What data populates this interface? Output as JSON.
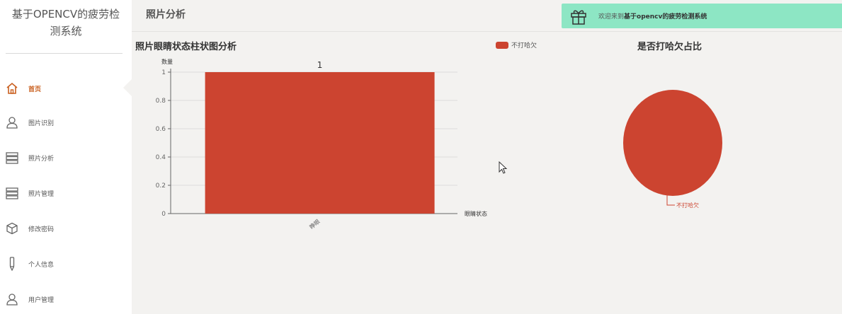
{
  "sidebar": {
    "app_title": "基于OPENCV的疲劳检测系统",
    "items": [
      {
        "label": "首页",
        "icon": "home-icon",
        "active": true
      },
      {
        "label": "图片识别",
        "icon": "user-icon"
      },
      {
        "label": "照片分析",
        "icon": "list-icon"
      },
      {
        "label": "照片管理",
        "icon": "list-icon"
      },
      {
        "label": "修改密码",
        "icon": "cube-icon"
      },
      {
        "label": "个人信息",
        "icon": "pen-icon"
      },
      {
        "label": "用户管理",
        "icon": "user-icon"
      }
    ]
  },
  "header": {
    "page_title": "照片分析",
    "welcome_prefix": "欢迎来到",
    "welcome_system": "基于opencv的疲劳检测系统"
  },
  "colors": {
    "accent": "#c95f1f",
    "series": "#cc4430",
    "welcome_bg": "#8de6c4"
  },
  "chart_data": [
    {
      "type": "bar",
      "title": "照片眼睛状态柱状图分析",
      "ylabel": "数量",
      "xlabel": "眼睛状态",
      "categories": [
        "睁眼"
      ],
      "series": [
        {
          "name": "不打哈欠",
          "values": [
            1
          ]
        }
      ],
      "ylim": [
        0,
        1
      ],
      "yticks": [
        "0",
        "0.2",
        "0.4",
        "0.6",
        "0.8",
        "1"
      ],
      "data_label": "1",
      "grid": true,
      "legend": "top"
    },
    {
      "type": "pie",
      "title": "是否打哈欠占比",
      "slices": [
        {
          "label": "不打哈欠",
          "value": 1
        }
      ]
    }
  ]
}
